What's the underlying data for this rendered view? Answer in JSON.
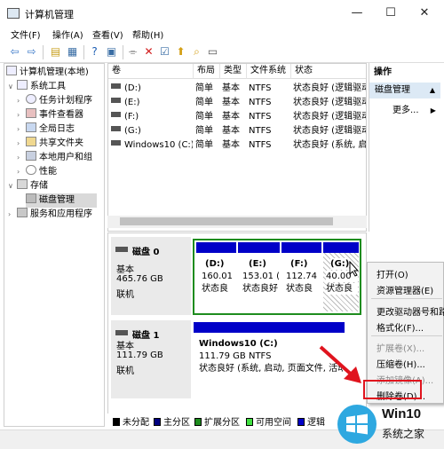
{
  "window": {
    "title": "计算机管理",
    "controls": [
      "—",
      "☐",
      "✕"
    ]
  },
  "menubar": [
    "文件(F)",
    "操作(A)",
    "查看(V)",
    "帮助(H)"
  ],
  "tree": {
    "root": "计算机管理(本地)",
    "system_tools": "系统工具",
    "task_scheduler": "任务计划程序",
    "event_viewer": "事件查看器",
    "shared_folders_log": "全局日志",
    "shared_folders": "共享文件夹",
    "local_users": "本地用户和组",
    "performance": "性能",
    "storage": "存储",
    "disk_management": "磁盘管理",
    "services": "服务和应用程序"
  },
  "volume_list": {
    "headers": [
      "卷",
      "布局",
      "类型",
      "文件系统",
      "状态"
    ],
    "rows": [
      [
        "(D:)",
        "简单",
        "基本",
        "NTFS",
        "状态良好 (逻辑驱动"
      ],
      [
        "(E:)",
        "简单",
        "基本",
        "NTFS",
        "状态良好 (逻辑驱动"
      ],
      [
        "(F:)",
        "简单",
        "基本",
        "NTFS",
        "状态良好 (逻辑驱动"
      ],
      [
        "(G:)",
        "简单",
        "基本",
        "NTFS",
        "状态良好 (逻辑驱动"
      ],
      [
        "Windows10 (C:)",
        "简单",
        "基本",
        "NTFS",
        "状态良好 (系统, 启动"
      ]
    ]
  },
  "actions": {
    "header": "操作",
    "selected": "磁盘管理",
    "more": "更多..."
  },
  "disk0": {
    "name": "磁盘 0",
    "type": "基本",
    "size": "465.76 GB",
    "status": "联机",
    "partitions": [
      {
        "label": "(D:)",
        "size": "160.01",
        "status": "状态良"
      },
      {
        "label": "(E:)",
        "size": "153.01 (",
        "status": "状态良好"
      },
      {
        "label": "(F:)",
        "size": "112.74",
        "status": "状态良"
      },
      {
        "label": "(G:)",
        "size": "40.00",
        "status": "状态良"
      }
    ]
  },
  "disk1": {
    "name": "磁盘 1",
    "type": "基本",
    "size": "111.79 GB",
    "status": "联机",
    "partition": {
      "label": "Windows10  (C:)",
      "size": "111.79 GB NTFS",
      "status": "状态良好 (系统, 启动, 页面文件, 活动"
    }
  },
  "legend": [
    "未分配",
    "主分区",
    "扩展分区",
    "可用空间",
    "逻辑"
  ],
  "legend_colors": [
    "#000000",
    "#000080",
    "#1e8c1e",
    "#40e040",
    "#0000c8"
  ],
  "context_menu": {
    "open": "打开(O)",
    "explorer": "资源管理器(E)",
    "change_letter": "更改驱动器号和路",
    "format": "格式化(F)...",
    "extend": "扩展卷(X)...",
    "shrink": "压缩卷(H)...",
    "mirror": "添加镜像(A)...",
    "delete": "删除卷(D)..."
  },
  "watermark": {
    "brand": "Win10",
    "sub": "系统之家"
  }
}
